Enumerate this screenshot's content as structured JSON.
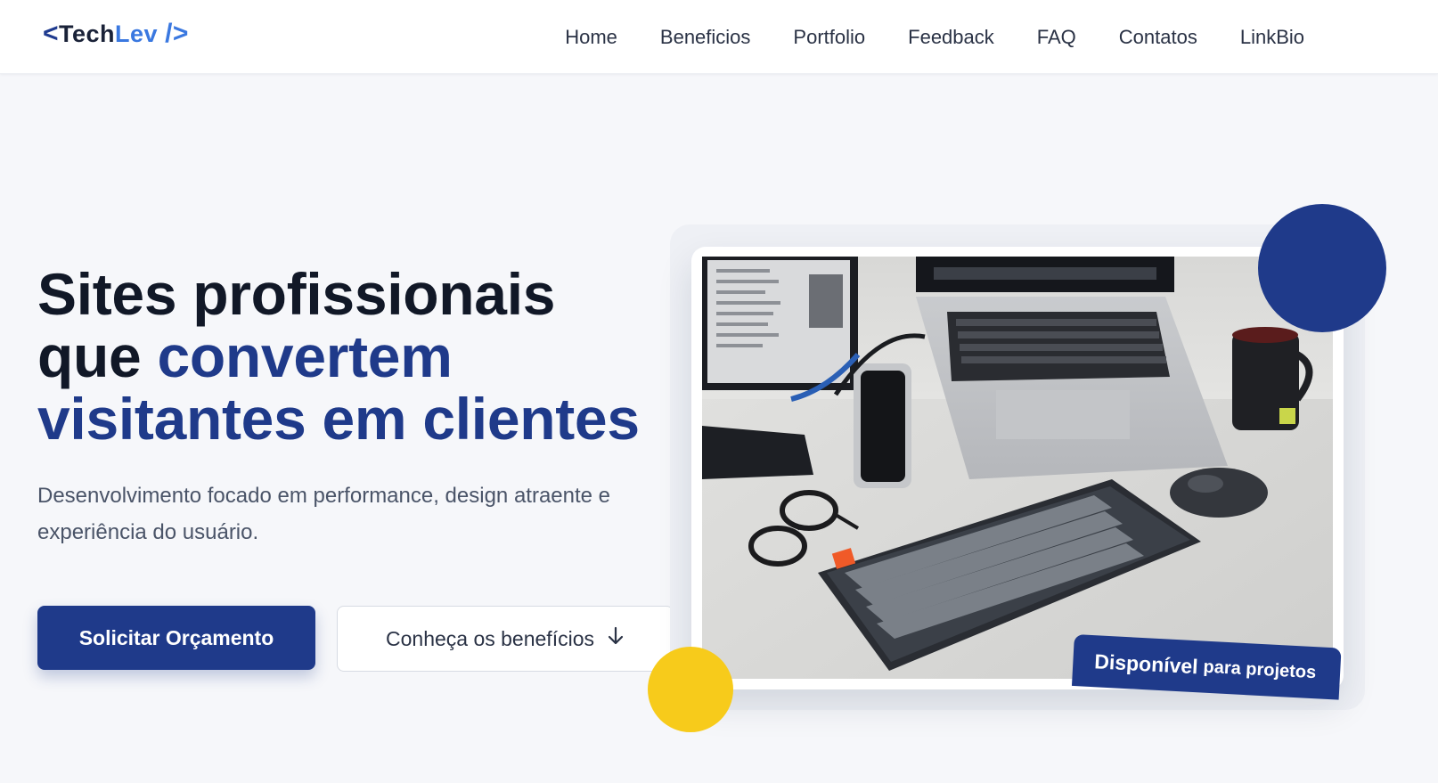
{
  "brand": {
    "open_bracket": "<",
    "part1": "Tech",
    "part2": "Lev",
    "close": "/>"
  },
  "nav": {
    "items": [
      "Home",
      "Beneficios",
      "Portfolio",
      "Feedback",
      "FAQ",
      "Contatos",
      "LinkBio"
    ]
  },
  "hero": {
    "title_line1": "Sites profissionais",
    "title_line2_plain": "que ",
    "title_line2_accent": "convertem",
    "title_line3": "visitantes em clientes",
    "subtitle": "Desenvolvimento focado em performance, design atraente e experiência do usuário.",
    "primary_button": "Solicitar Orçamento",
    "secondary_button": "Conheça os benefícios",
    "secondary_icon": "arrow-down-icon"
  },
  "image_card": {
    "badge_text_main": "Disponível",
    "badge_text_small": "para projetos"
  },
  "colors": {
    "primary": "#1f3a8a",
    "accent_light": "#3a78e0",
    "yellow": "#f7cb1b",
    "background": "#f6f7fa"
  }
}
